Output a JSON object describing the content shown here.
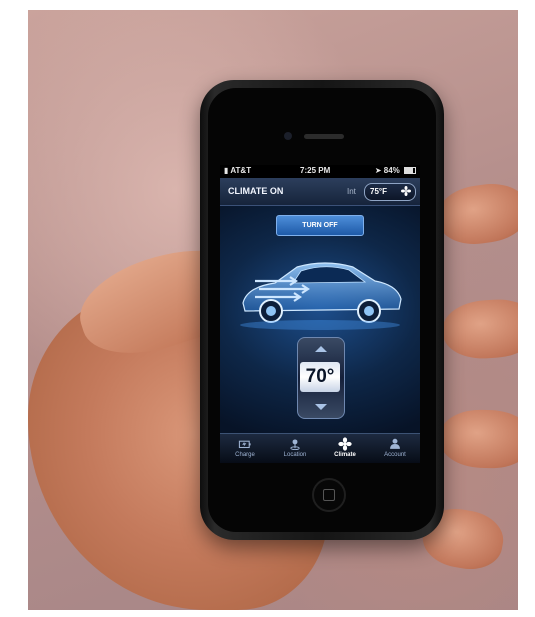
{
  "status_bar": {
    "carrier": "AT&T",
    "time": "7:25 PM",
    "battery": "84%"
  },
  "header": {
    "status": "CLIMATE ON",
    "zone_label": "Int",
    "interior_temp": "75°F"
  },
  "main": {
    "turn_off_label": "TURN OFF",
    "set_temperature": "70°"
  },
  "tabs": [
    {
      "label": "Charge",
      "icon": "charge-icon",
      "active": false
    },
    {
      "label": "Location",
      "icon": "location-icon",
      "active": false
    },
    {
      "label": "Climate",
      "icon": "fan-icon",
      "active": true
    },
    {
      "label": "Account",
      "icon": "person-icon",
      "active": false
    }
  ],
  "colors": {
    "accent_blue": "#1e5aa8",
    "screen_dark": "#0a1528",
    "skin": "#c47a5c"
  }
}
